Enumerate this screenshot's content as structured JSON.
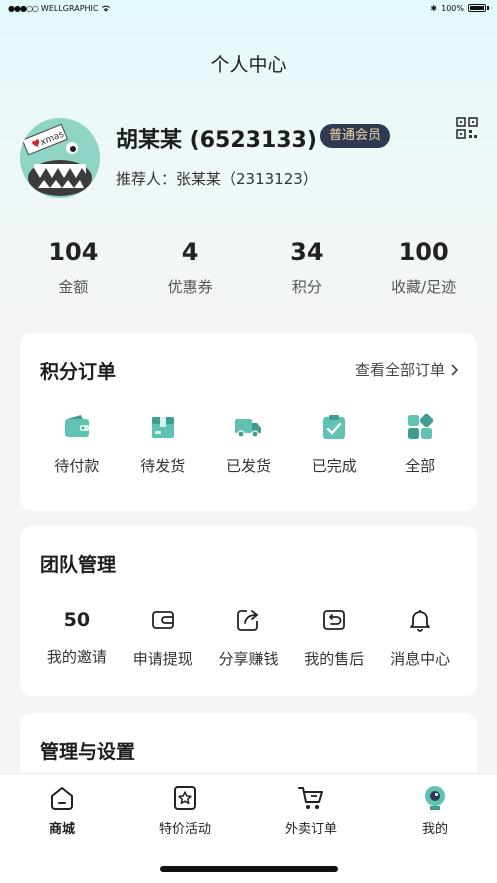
{
  "status_bar": {
    "carrier": "WELLGRAPHIC",
    "battery": "100%"
  },
  "page_title": "个人中心",
  "profile": {
    "name": "胡某某 (6523133)",
    "member_level": "普通会员",
    "referrer": "推荐人：张某某（2313123）",
    "avatar_tag": "xmas"
  },
  "stats": [
    {
      "value": "104",
      "label": "金额"
    },
    {
      "value": "4",
      "label": "优惠券"
    },
    {
      "value": "34",
      "label": "积分"
    },
    {
      "value": "100",
      "label": "收藏/足迹"
    }
  ],
  "orders": {
    "title": "积分订单",
    "view_all": "查看全部订单",
    "items": [
      {
        "label": "待付款",
        "icon": "wallet-icon"
      },
      {
        "label": "待发货",
        "icon": "box-icon"
      },
      {
        "label": "已发货",
        "icon": "truck-icon"
      },
      {
        "label": "已完成",
        "icon": "clipboard-check-icon"
      },
      {
        "label": "全部",
        "icon": "grid-icon"
      }
    ]
  },
  "team": {
    "title": "团队管理",
    "invite_count": "50",
    "items": [
      {
        "label": "我的邀请"
      },
      {
        "label": "申请提现",
        "icon": "wallet-outline-icon"
      },
      {
        "label": "分享赚钱",
        "icon": "share-icon"
      },
      {
        "label": "我的售后",
        "icon": "return-icon"
      },
      {
        "label": "消息中心",
        "icon": "bell-icon"
      }
    ]
  },
  "settings": {
    "title": "管理与设置"
  },
  "tabbar": [
    {
      "label": "商城",
      "icon": "home-icon",
      "active": true
    },
    {
      "label": "特价活动",
      "icon": "star-bookmark-icon"
    },
    {
      "label": "外卖订单",
      "icon": "cart-icon"
    },
    {
      "label": "我的",
      "icon": "profile-avatar-icon"
    }
  ],
  "colors": {
    "accent": "#4fb3a6",
    "badge_bg": "#2e3a52",
    "badge_text": "#f2d6a5"
  }
}
